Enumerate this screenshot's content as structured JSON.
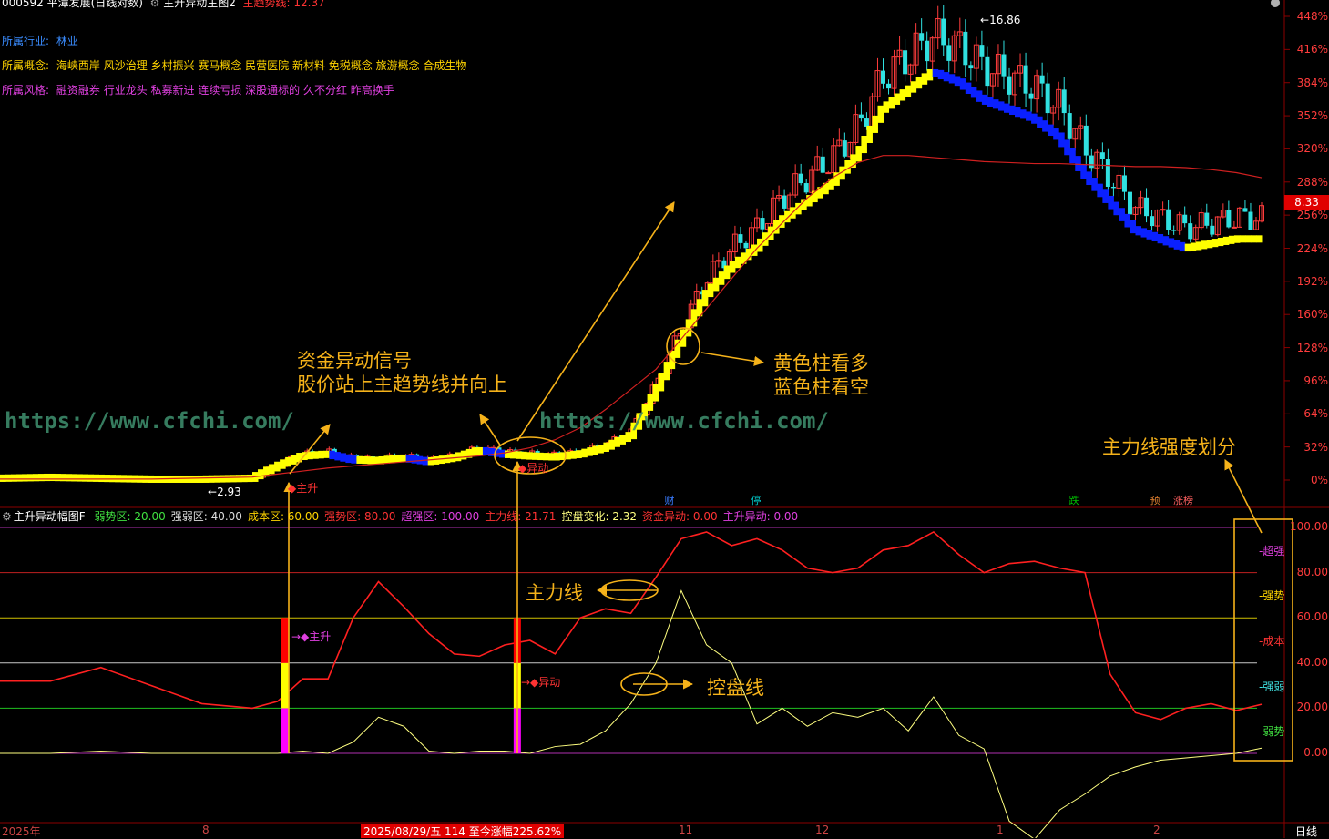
{
  "header": {
    "title": "000592 平潭发展(日线对数)",
    "indicator_name": "主升异动主图2",
    "main_trend_label": "主趋势线:",
    "main_trend_value": "12.37"
  },
  "info": [
    {
      "key": "所属行业:",
      "value": "林业",
      "key_color": "#3a8cff",
      "value_color": "#3a8cff"
    },
    {
      "key": "所属概念:",
      "value": "海峡西岸 风沙治理 乡村振兴 赛马概念 民营医院 新材料 免税概念 旅游概念 合成生物",
      "key_color": "#ffd400",
      "value_color": "#ffd400"
    },
    {
      "key": "所属风格:",
      "value": "融资融券 行业龙头 私募新进 连续亏损 深股通标的 久不分红 昨高换手",
      "key_color": "#e040e0",
      "value_color": "#e040e0"
    }
  ],
  "watermarks": [
    "https://www.cfchi.com/",
    "https://www.cfchi.com/"
  ],
  "annotations": {
    "signal_line1": "资金异动信号",
    "signal_line2": "股价站上主趋势线并向上",
    "bull_bear_line1": "黄色柱看多",
    "bull_bear_line2": "蓝色柱看空",
    "strength_division": "主力线强度划分",
    "main_line": "主力线",
    "control_line": "控盘线"
  },
  "price_axis": {
    "labels": [
      "448%",
      "416%",
      "384%",
      "352%",
      "320%",
      "288%",
      "256%",
      "224%",
      "192%",
      "160%",
      "128%",
      "96%",
      "64%",
      "32%",
      "0%"
    ],
    "current_price": "8.33"
  },
  "price_marks": {
    "high": "16.86",
    "low": "2.93"
  },
  "signal_tags": {
    "zhusheng": "主升",
    "yidong": "异动"
  },
  "event_badges": [
    {
      "text": "财",
      "color": "#3a7cff"
    },
    {
      "text": "停",
      "color": "#00b0b0"
    },
    {
      "text": "跌",
      "color": "#00b000"
    },
    {
      "text": "预",
      "color": "#c87020"
    },
    {
      "text": "涨榜",
      "color": "#c03030"
    }
  ],
  "indicator": {
    "name": "主升异动幅图F",
    "params": [
      {
        "label": "弱势区:",
        "value": "20.00",
        "color": "#40e040"
      },
      {
        "label": "强弱区:",
        "value": "40.00",
        "color": "#dddddd"
      },
      {
        "label": "成本区:",
        "value": "60.00",
        "color": "#ffd400"
      },
      {
        "label": "强势区:",
        "value": "80.00",
        "color": "#ff3333"
      },
      {
        "label": "超强区:",
        "value": "100.00",
        "color": "#e040e0"
      },
      {
        "label": "主力线:",
        "value": "21.71",
        "color": "#ff3333"
      },
      {
        "label": "控盘变化:",
        "value": "2.32",
        "color": "#ffff80"
      },
      {
        "label": "资金异动:",
        "value": "0.00",
        "color": "#ff3333"
      },
      {
        "label": "主升异动:",
        "value": "0.00",
        "color": "#e040e0"
      }
    ],
    "axis_labels": [
      "100.00",
      "80.00",
      "60.00",
      "40.00",
      "20.00",
      "0.00"
    ],
    "zone_labels": [
      {
        "text": "超强",
        "color": "#e040e0"
      },
      {
        "text": "强势",
        "color": "#ffd400"
      },
      {
        "text": "成本",
        "color": "#ff3333"
      },
      {
        "text": "强弱",
        "color": "#40e0e0"
      },
      {
        "text": "弱势",
        "color": "#40e040"
      }
    ],
    "signal_tags": {
      "zhusheng": "主升",
      "yidong": "异动"
    }
  },
  "bottom_axis": {
    "labels": [
      "2025年",
      "8",
      "11",
      "12",
      "1",
      "2"
    ],
    "cursor_info": "2025/08/29/五 114 至今涨幅225.62%",
    "period": "日线"
  },
  "chart_data": [
    {
      "type": "line",
      "title": "",
      "x": [
        0,
        20,
        40,
        60,
        80,
        100,
        110,
        120,
        130,
        140,
        150,
        160,
        170,
        180,
        190,
        200,
        210,
        220,
        230,
        240,
        250,
        260,
        270,
        280,
        290,
        300,
        310,
        320,
        330,
        340,
        350,
        360,
        370,
        380,
        390,
        400,
        410,
        420,
        430,
        440,
        450,
        460,
        470,
        480,
        490,
        500
      ],
      "series": [
        {
          "name": "",
          "values": [
            2,
            3,
            2,
            1,
            1,
            2,
            15,
            26,
            28,
            22,
            21,
            24,
            20,
            24,
            32,
            28,
            26,
            25,
            28,
            35,
            48,
            95,
            150,
            200,
            230,
            250,
            280,
            300,
            320,
            350,
            400,
            420,
            440,
            430,
            410,
            400,
            390,
            370,
            330,
            300,
            270,
            260,
            250,
            255,
            260,
            260
          ],
          "color": "#ffffff"
        },
        {
          "name": "",
          "values": [
            1,
            1,
            1,
            1,
            2,
            3,
            6,
            9,
            12,
            14,
            16,
            18,
            20,
            22,
            24,
            27,
            32,
            40,
            52,
            70,
            90,
            110,
            140,
            170,
            200,
            230,
            255,
            280,
            300,
            315,
            322,
            322,
            320,
            318,
            316,
            315,
            314,
            314,
            313,
            312,
            311,
            311,
            310,
            308,
            305,
            300
          ],
          "color": "#d02020"
        }
      ],
      "ylim": [
        0,
        460
      ]
    },
    {
      "type": "line",
      "title": "",
      "x": [
        0,
        20,
        40,
        60,
        80,
        100,
        110,
        120,
        130,
        140,
        150,
        160,
        170,
        180,
        190,
        200,
        210,
        220,
        230,
        240,
        250,
        260,
        270,
        280,
        290,
        300,
        310,
        320,
        330,
        340,
        350,
        360,
        370,
        380,
        390,
        400,
        410,
        420,
        430,
        440,
        450,
        460,
        470,
        480,
        490,
        500
      ],
      "series": [
        {
          "name": "主力线",
          "values": [
            32,
            32,
            38,
            30,
            22,
            20,
            23,
            33,
            33,
            60,
            76,
            65,
            53,
            44,
            43,
            48,
            50,
            44,
            60,
            64,
            62,
            78,
            95,
            98,
            92,
            95,
            90,
            82,
            80,
            82,
            90,
            92,
            98,
            88,
            80,
            84,
            85,
            82,
            80,
            35,
            18,
            15,
            20,
            22,
            19,
            21.71
          ],
          "color": "#ff2020"
        },
        {
          "name": "控盘线",
          "values": [
            0,
            0,
            1,
            0,
            0,
            0,
            0,
            1,
            0,
            5,
            16,
            12,
            1,
            0,
            1,
            1,
            0,
            3,
            4,
            10,
            22,
            40,
            72,
            48,
            40,
            13,
            20,
            12,
            18,
            16,
            20,
            10,
            25,
            8,
            2,
            -30,
            -38,
            -25,
            -18,
            -10,
            -6,
            -3,
            -2,
            -1,
            0,
            2.32
          ],
          "color": "#ffff80"
        }
      ],
      "zones": [
        {
          "name": "超强区",
          "value": 100
        },
        {
          "name": "强势区",
          "value": 80
        },
        {
          "name": "成本区",
          "value": 60
        },
        {
          "name": "强弱区",
          "value": 40
        },
        {
          "name": "弱势区",
          "value": 20
        }
      ],
      "ylim": [
        -40,
        105
      ]
    }
  ]
}
